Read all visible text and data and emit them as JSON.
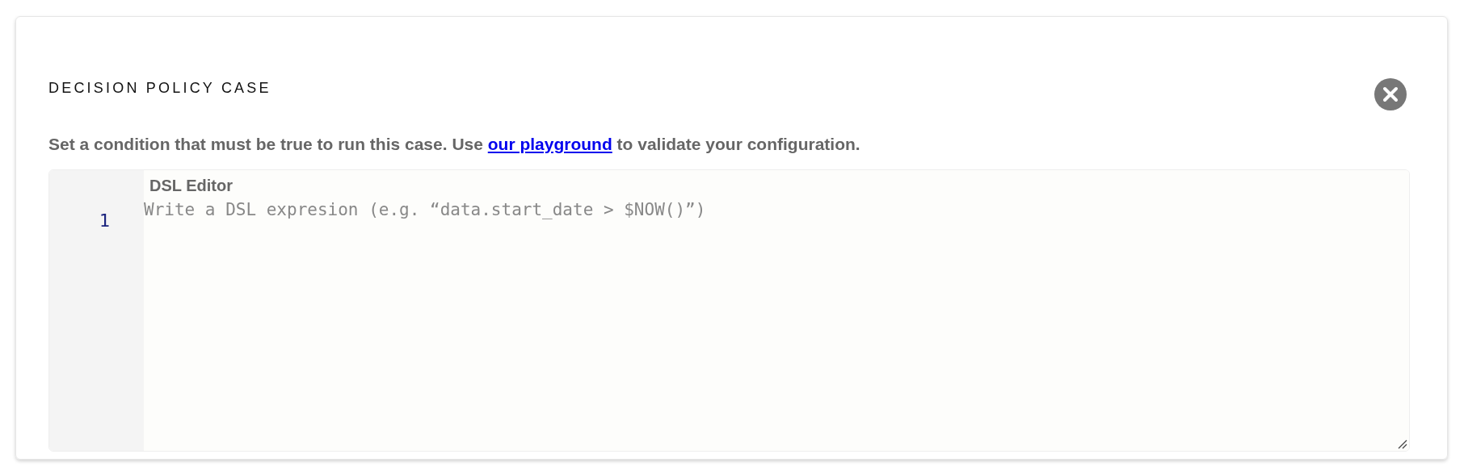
{
  "dialog": {
    "title": "DECISION POLICY CASE",
    "description": {
      "before": "Set a condition that must be true to run this case. Use ",
      "link": "our playground",
      "after": " to validate your configuration."
    },
    "editor": {
      "label": "DSL Editor",
      "line_numbers": [
        "1"
      ],
      "placeholder": "Write a DSL expresion (e.g. “data.start_date > $NOW()”)"
    }
  }
}
